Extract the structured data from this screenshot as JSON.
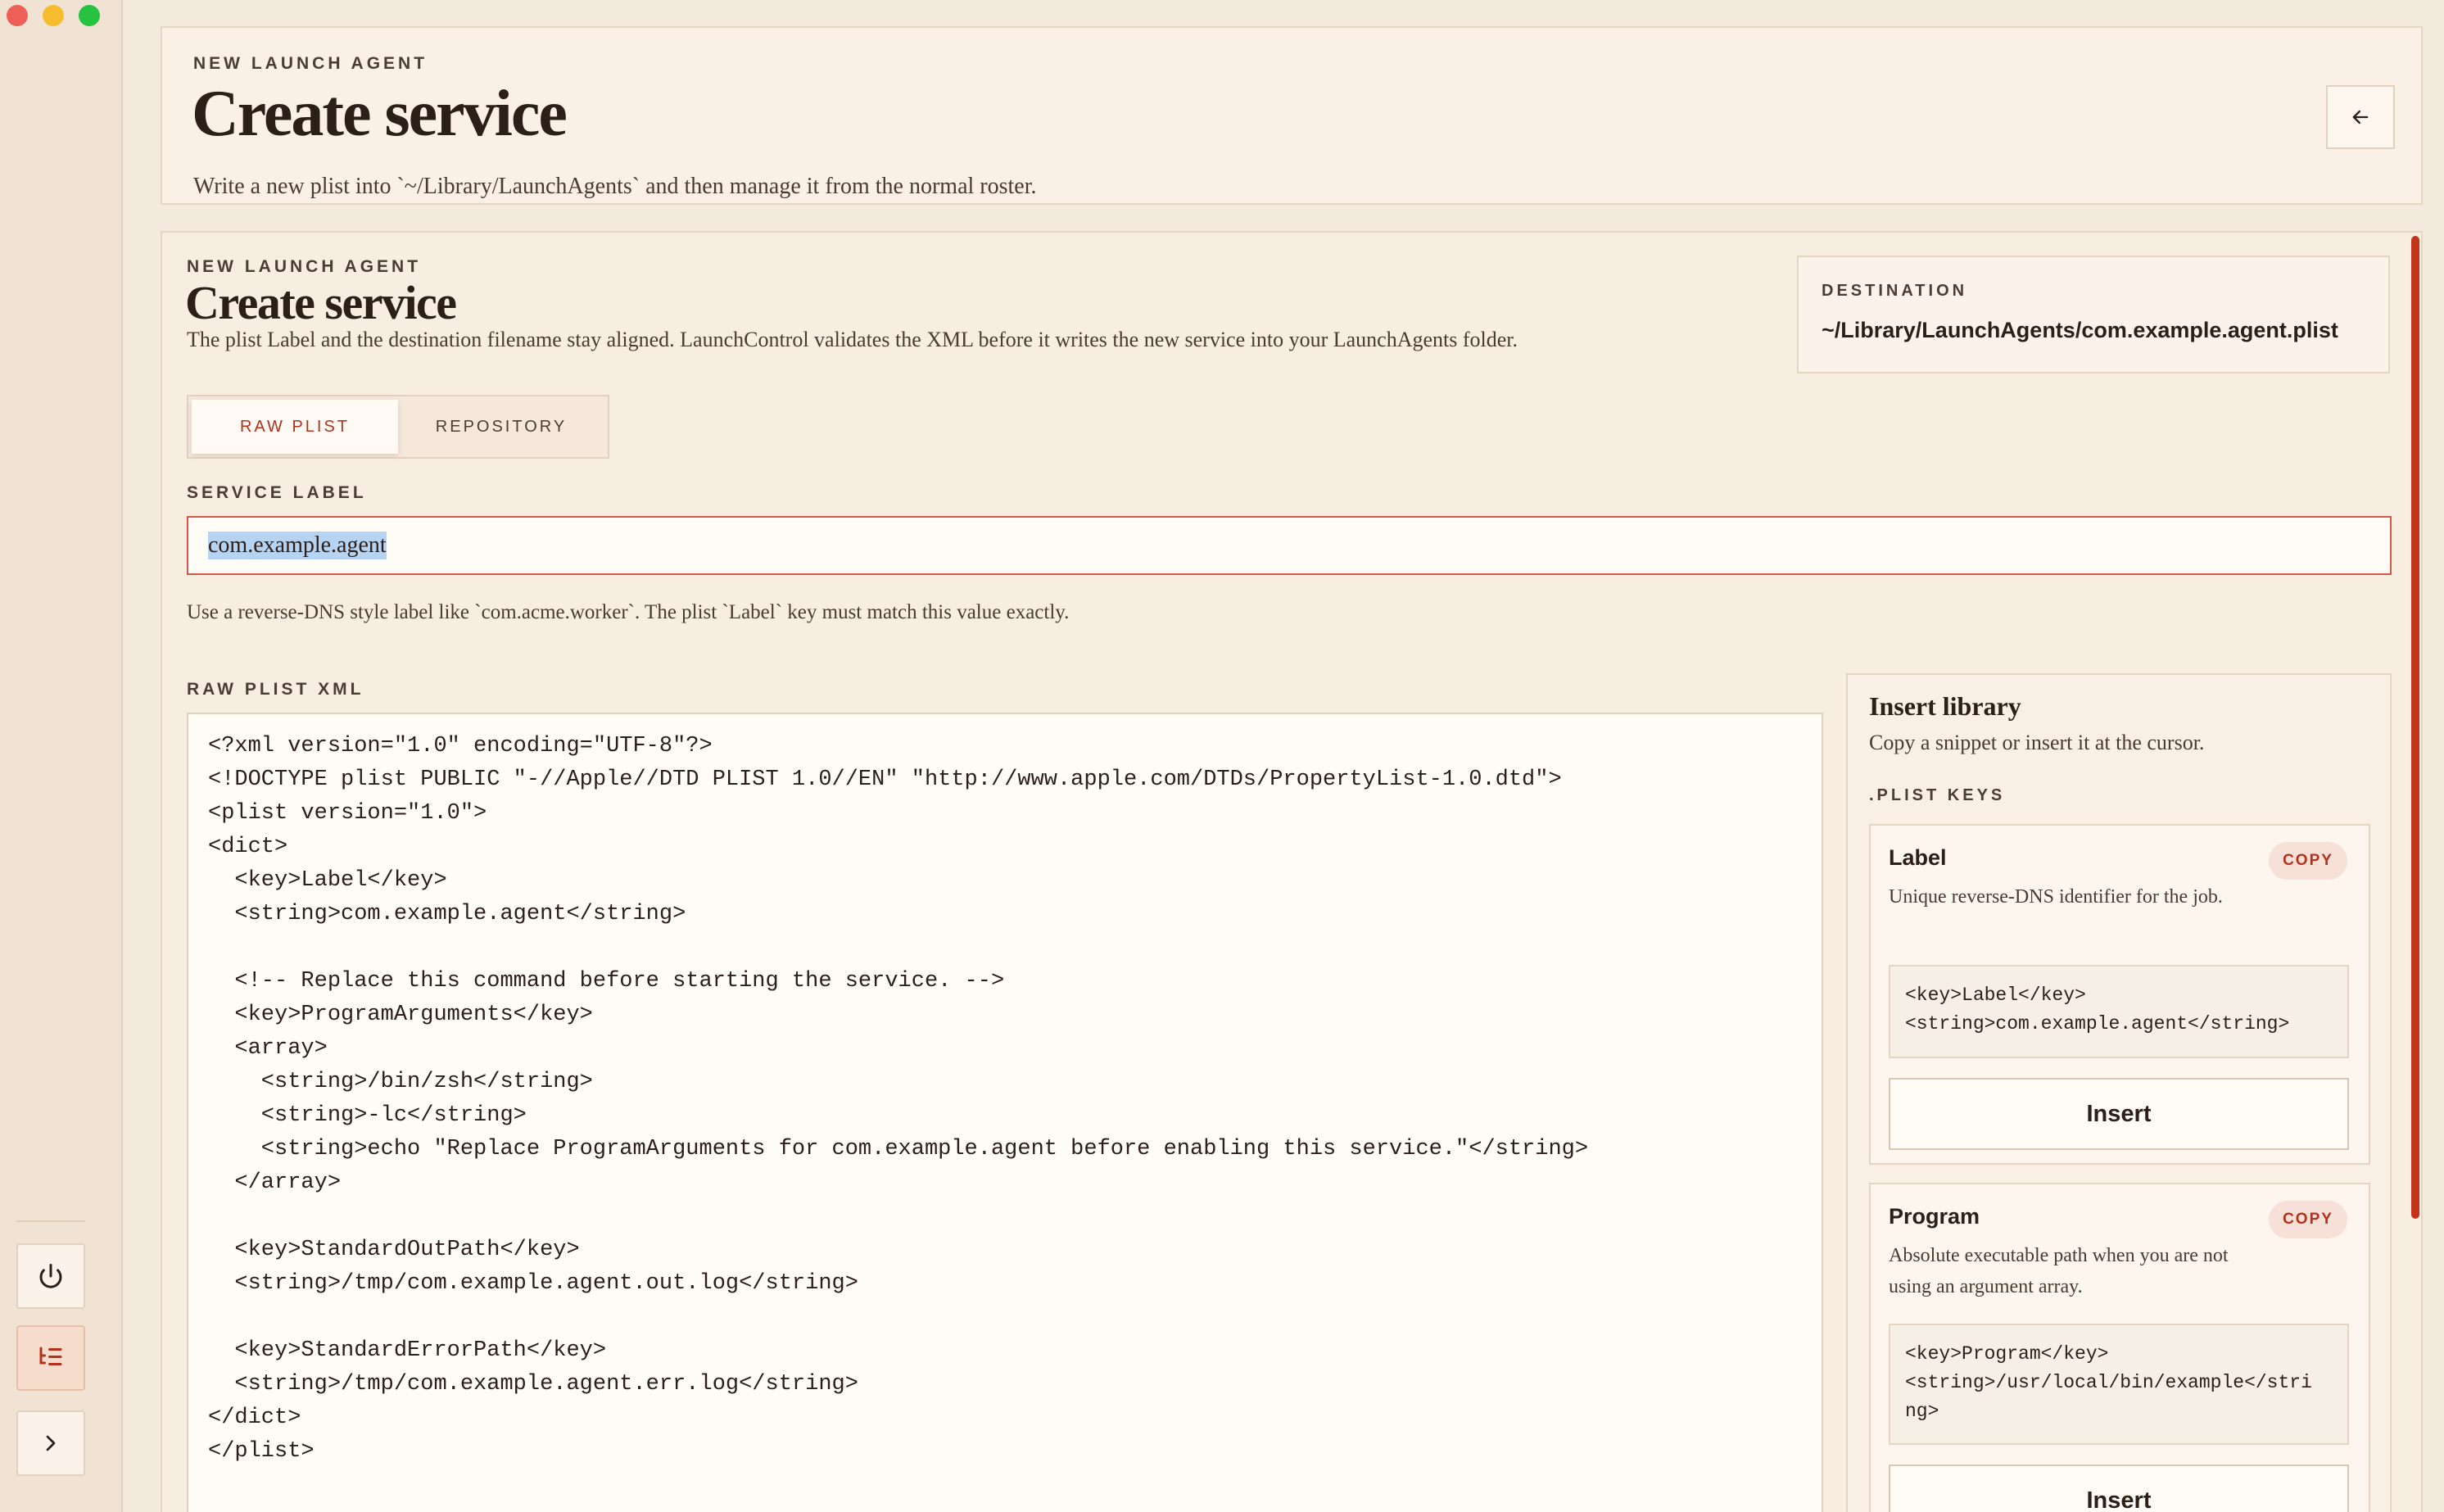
{
  "header": {
    "eyebrow": "NEW LAUNCH AGENT",
    "title": "Create service",
    "subtitle": "Write a new plist into `~/Library/LaunchAgents` and then manage it from the normal roster."
  },
  "main": {
    "eyebrow": "NEW LAUNCH AGENT",
    "title": "Create service",
    "description": "The plist Label and the destination filename stay aligned. LaunchControl validates the XML before it writes the new service into your LaunchAgents folder.",
    "destination": {
      "label": "DESTINATION",
      "value": "~/Library/LaunchAgents/com.example.agent.plist"
    },
    "tabs": [
      {
        "label": "RAW PLIST",
        "active": true
      },
      {
        "label": "REPOSITORY",
        "active": false
      }
    ],
    "service_label": {
      "label": "SERVICE LABEL",
      "value": "com.example.agent",
      "hint": "Use a reverse-DNS style label like `com.acme.worker`. The plist `Label` key must match this value exactly."
    },
    "xml": {
      "label": "RAW PLIST XML",
      "lines": [
        "<?xml version=\"1.0\" encoding=\"UTF-8\"?>",
        "<!DOCTYPE plist PUBLIC \"-//Apple//DTD PLIST 1.0//EN\" \"http://www.apple.com/DTDs/PropertyList-1.0.dtd\">",
        "<plist version=\"1.0\">",
        "<dict>",
        "  <key>Label</key>",
        "  <string>com.example.agent</string>",
        "",
        "  <!-- Replace this command before starting the service. -->",
        "  <key>ProgramArguments</key>",
        "  <array>",
        "    <string>/bin/zsh</string>",
        "    <string>-lc</string>",
        "    <string>echo \"Replace ProgramArguments for com.example.agent before enabling this service.\"</string>",
        "  </array>",
        "",
        "  <key>StandardOutPath</key>",
        "  <string>/tmp/com.example.agent.out.log</string>",
        "",
        "  <key>StandardErrorPath</key>",
        "  <string>/tmp/com.example.agent.err.log</string>",
        "</dict>",
        "</plist>"
      ]
    }
  },
  "library": {
    "title": "Insert library",
    "subtitle": "Copy a snippet or insert it at the cursor.",
    "section": ".PLIST KEYS",
    "copy_label": "COPY",
    "insert_label": "Insert",
    "snippets": [
      {
        "name": "Label",
        "description": "Unique reverse-DNS identifier for the job.",
        "code": "<key>Label</key>\n<string>com.example.agent</string>"
      },
      {
        "name": "Program",
        "description": "Absolute executable path when you are not using an argument array.",
        "code": "<key>Program</key>\n<string>/usr/local/bin/example</stri\nng>"
      }
    ]
  },
  "colors": {
    "accent": "#b2321c",
    "background": "#f4e9dd",
    "selection": "#b7d3f2"
  },
  "icons": {
    "back": "arrow-left-icon",
    "power": "power-icon",
    "list": "list-tree-icon",
    "expand": "chevron-right-icon"
  }
}
